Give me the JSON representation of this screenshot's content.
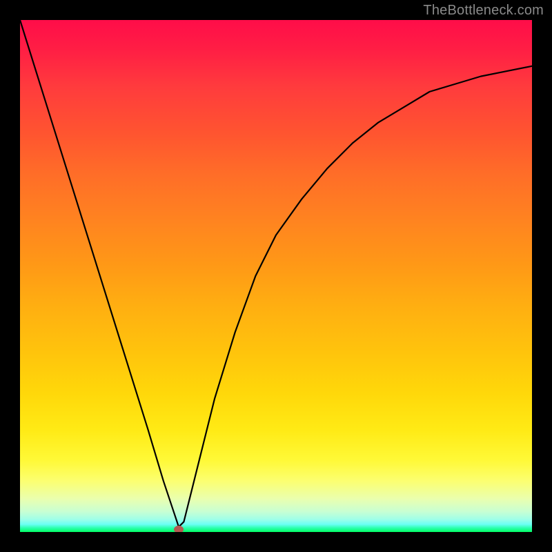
{
  "watermark": "TheBottleneck.com",
  "chart_data": {
    "type": "line",
    "title": "",
    "xlabel": "",
    "ylabel": "",
    "xlim": [
      0,
      100
    ],
    "ylim": [
      0,
      100
    ],
    "grid": false,
    "legend": "none",
    "series": [
      {
        "name": "curve",
        "x": [
          0,
          5,
          10,
          15,
          20,
          25,
          28,
          30,
          31,
          32,
          34,
          38,
          42,
          46,
          50,
          55,
          60,
          65,
          70,
          75,
          80,
          85,
          90,
          95,
          100
        ],
        "values": [
          100,
          84,
          68,
          52,
          36,
          20,
          10,
          4,
          1,
          2,
          10,
          26,
          39,
          50,
          58,
          65,
          71,
          76,
          80,
          83,
          86,
          87.5,
          89,
          90,
          91
        ]
      }
    ],
    "marker": {
      "x": 31,
      "y": 0.5
    },
    "colors": {
      "top": "#ff0d49",
      "bottom": "#00ff63",
      "curve": "#000000",
      "marker": "#b55a52",
      "frame": "#000000",
      "watermark": "#8a8a8a"
    }
  }
}
